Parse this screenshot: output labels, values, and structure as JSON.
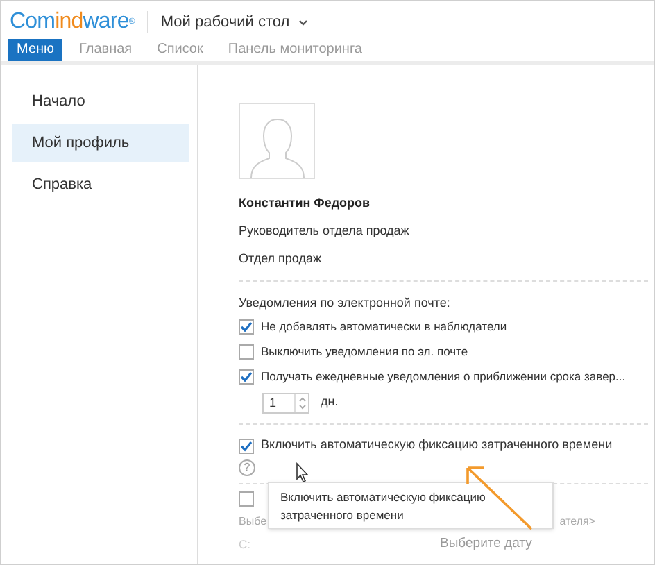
{
  "logo": {
    "text": "Comindware",
    "mark": "®"
  },
  "workspace": {
    "title": "Мой рабочий стол"
  },
  "tabs": [
    {
      "label": "Меню",
      "selected": true
    },
    {
      "label": "Главная",
      "selected": false
    },
    {
      "label": "Список",
      "selected": false
    },
    {
      "label": "Панель мониторинга",
      "selected": false
    }
  ],
  "sidebar": {
    "items": [
      {
        "label": "Начало",
        "selected": false
      },
      {
        "label": "Мой профиль",
        "selected": true
      },
      {
        "label": "Справка",
        "selected": false
      }
    ]
  },
  "profile": {
    "name": "Константин Федоров",
    "position": "Руководитель отдела продаж",
    "department": "Отдел продаж"
  },
  "notifications": {
    "heading": "Уведомления по электронной почте:",
    "options": [
      {
        "label": "Не добавлять автоматически в наблюдатели",
        "checked": true
      },
      {
        "label": "Выключить уведомления по эл. почте",
        "checked": false
      },
      {
        "label": "Получать ежедневные уведомления о приближении срока завер...",
        "checked": true
      }
    ],
    "days": {
      "value": "1",
      "unit": "дн."
    }
  },
  "time_tracking": {
    "label": "Включить автоматическую фиксацию затраченного времени",
    "checked": true,
    "help": "?"
  },
  "replacement": {
    "checked": false,
    "select_left": "Выбе",
    "select_right": "ателя>",
    "from_label": "С:",
    "date_placeholder": "Выберите дату"
  },
  "tooltip": {
    "text": "Включить автоматическую фиксацию затраченного времени"
  }
}
